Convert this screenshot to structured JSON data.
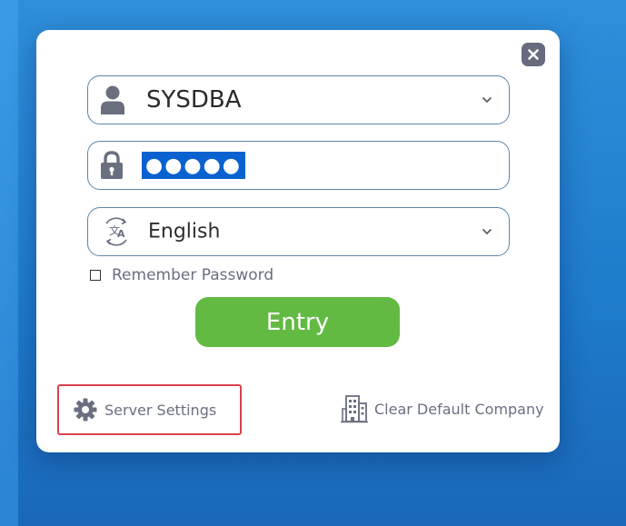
{
  "login": {
    "username": {
      "value": "SYSDBA",
      "icon": "user-icon"
    },
    "password": {
      "value": "●●●●●",
      "icon": "lock-icon"
    },
    "language": {
      "value": "English",
      "icon": "translate-icon"
    },
    "remember_label": "Remember Password",
    "remember_checked": false,
    "entry_label": "Entry"
  },
  "footer": {
    "server_settings_label": "Server Settings",
    "clear_company_label": "Clear Default Company"
  },
  "colors": {
    "background": "#1f7ccc",
    "field_border": "#5f86a8",
    "entry_button": "#63ba43",
    "selection": "#0a62d0",
    "highlight_border": "#d9414d",
    "muted_text": "#6a6f80",
    "close_button": "#666b7d"
  }
}
